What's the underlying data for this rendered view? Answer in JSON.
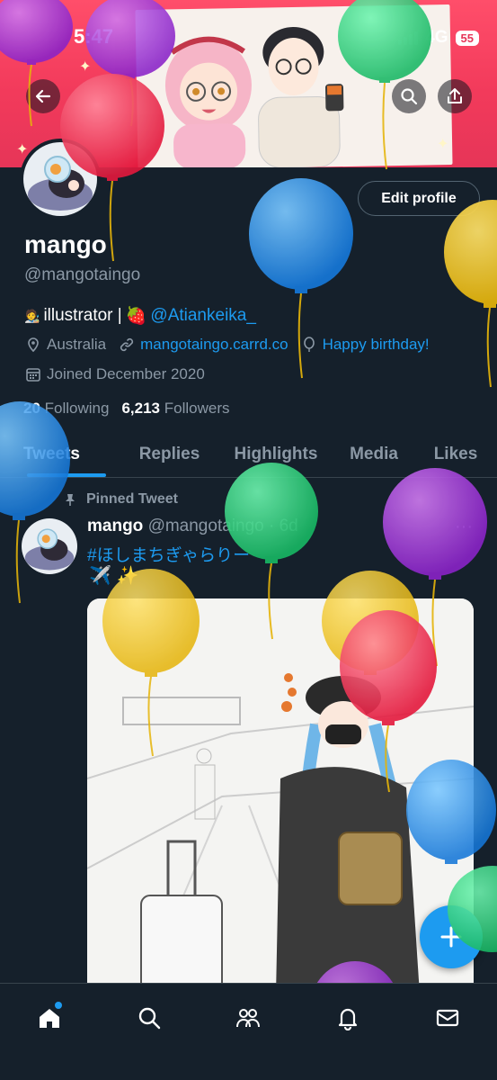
{
  "status_bar": {
    "time": "5:47",
    "network": "4G",
    "battery": "55"
  },
  "profile": {
    "name": "mango",
    "handle": "@mangotaingo",
    "bio_text": "illustrator |",
    "bio_mention": "@Atiankeika_",
    "location": "Australia",
    "website": "mangotaingo.carrd.co",
    "birthday": "Happy birthday!",
    "joined": "Joined December 2020",
    "following_count": "20",
    "following_label": "Following",
    "followers_count": "6,213",
    "followers_label": "Followers",
    "edit_label": "Edit profile"
  },
  "tabs": [
    {
      "label": "Tweets",
      "active": true
    },
    {
      "label": "Replies"
    },
    {
      "label": "Highlights"
    },
    {
      "label": "Media"
    },
    {
      "label": "Likes"
    }
  ],
  "tweet": {
    "pinned_label": "Pinned Tweet",
    "author": "mango",
    "handle": "@mangotaingo",
    "time": "· 6d",
    "text": "#ほしまちぎゃらりー",
    "emoji": "✈️ ✨"
  },
  "icons": [
    "back-arrow-icon",
    "search-icon",
    "share-icon",
    "location-icon",
    "link-icon",
    "balloon-icon",
    "calendar-icon",
    "pin-icon",
    "compose-plus-icon",
    "home-icon",
    "spaces-icon",
    "communities-icon",
    "bell-icon",
    "mail-icon"
  ],
  "colors": {
    "accent": "#1d9bf0",
    "background": "#15202b",
    "muted": "#8b98a5",
    "banner": "#f23a5b"
  }
}
